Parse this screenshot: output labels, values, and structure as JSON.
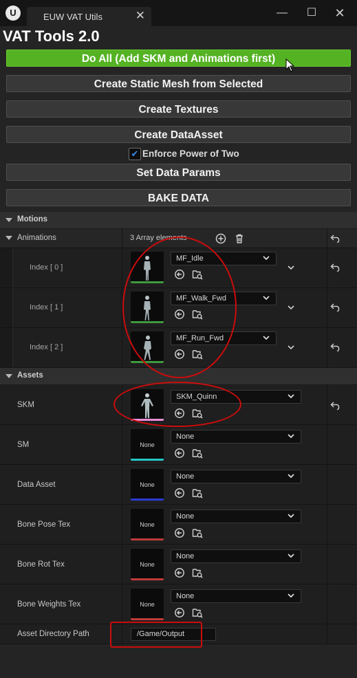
{
  "window": {
    "tab_title": "EUW VAT Utils",
    "tab_close": "✕",
    "minimize": "—",
    "maximize": "☐",
    "close": "✕"
  },
  "header": {
    "title": "VAT Tools 2.0",
    "buttons": {
      "do_all": "Do All (Add SKM and Animations first)",
      "create_static_mesh": "Create Static Mesh from Selected",
      "create_textures": "Create Textures",
      "create_data_asset": "Create DataAsset",
      "set_data_params": "Set Data Params",
      "bake_data": "BAKE DATA"
    },
    "enforce_pow2": {
      "label": "Enforce Power of Two",
      "checked": true
    }
  },
  "motions": {
    "section_label": "Motions",
    "animations_label": "Animations",
    "array_count": "3 Array elements",
    "items": [
      {
        "index_label": "Index [ 0 ]",
        "asset": "MF_Idle"
      },
      {
        "index_label": "Index [ 1 ]",
        "asset": "MF_Walk_Fwd"
      },
      {
        "index_label": "Index [ 2 ]",
        "asset": "MF_Run_Fwd"
      }
    ]
  },
  "assets": {
    "section_label": "Assets",
    "rows": [
      {
        "label": "SKM",
        "value": "SKM_Quinn",
        "thumb": "",
        "accent": "#e88ed8"
      },
      {
        "label": "SM",
        "value": "None",
        "thumb": "None",
        "accent": "#23c7c7"
      },
      {
        "label": "Data Asset",
        "value": "None",
        "thumb": "None",
        "accent": "#2a3bd6"
      },
      {
        "label": "Bone Pose Tex",
        "value": "None",
        "thumb": "None",
        "accent": "#c03a3a"
      },
      {
        "label": "Bone Rot Tex",
        "value": "None",
        "thumb": "None",
        "accent": "#c03a3a"
      },
      {
        "label": "Bone Weights Tex",
        "value": "None",
        "thumb": "None",
        "accent": "#c03a3a"
      }
    ],
    "directory_label": "Asset Directory Path",
    "directory_value": "/Game/Output"
  },
  "colors": {
    "do_all_green": "#54b223",
    "anim_accent": "#3f9a3f",
    "highlight_red": "#cc0c0c"
  }
}
